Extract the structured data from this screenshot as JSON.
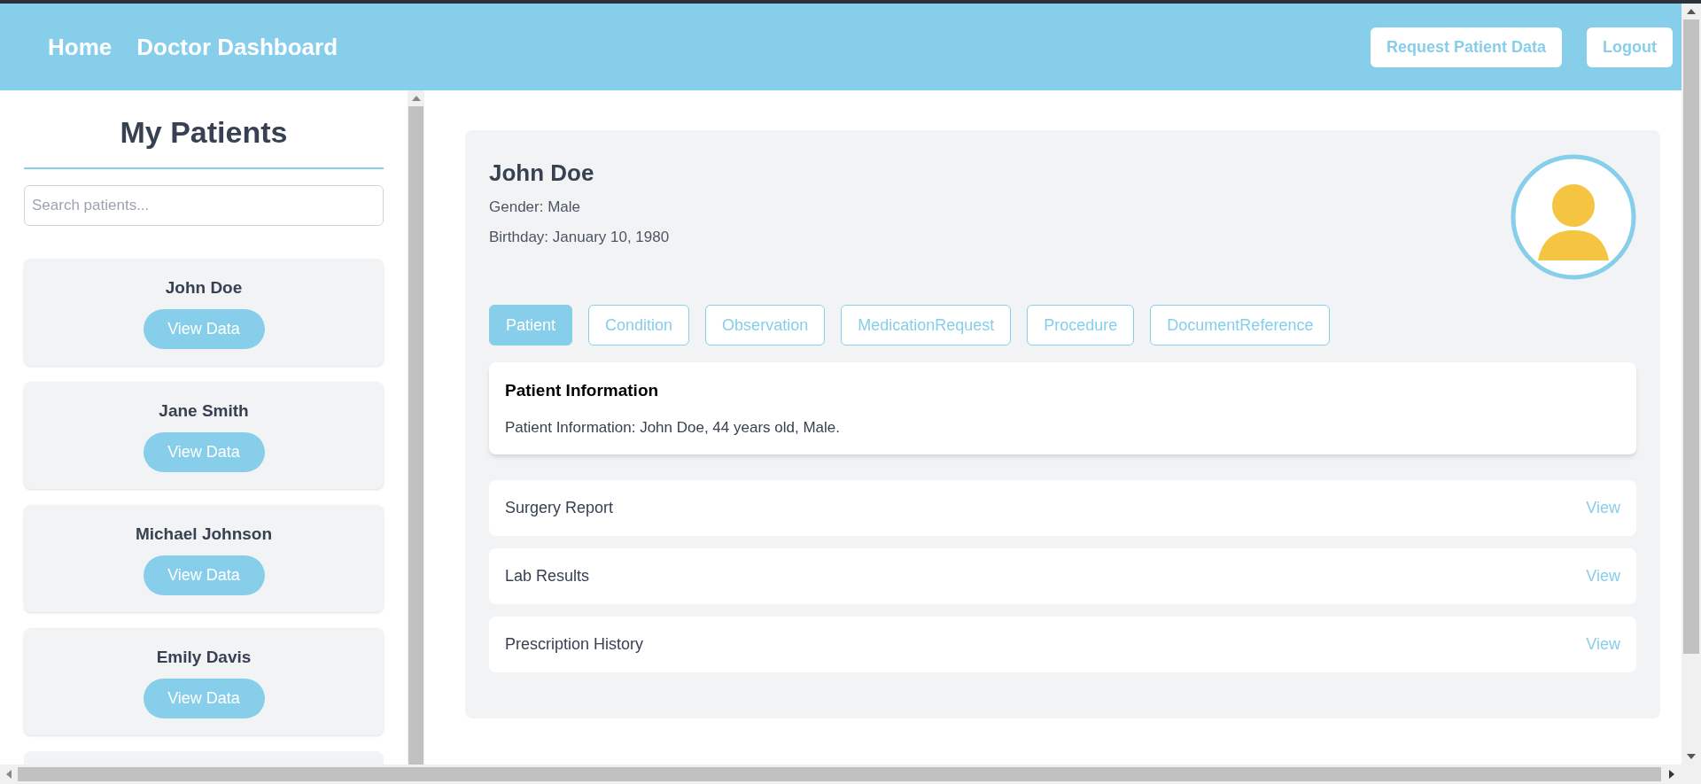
{
  "nav": {
    "links": [
      "Home",
      "Doctor Dashboard"
    ],
    "buttons": [
      "Request Patient Data",
      "Logout"
    ]
  },
  "sidebar": {
    "title": "My Patients",
    "search": {
      "placeholder": "Search patients..."
    },
    "patients": [
      {
        "name": "John Doe",
        "action": "View Data"
      },
      {
        "name": "Jane Smith",
        "action": "View Data"
      },
      {
        "name": "Michael Johnson",
        "action": "View Data"
      },
      {
        "name": "Emily Davis",
        "action": "View Data"
      }
    ]
  },
  "patient": {
    "name": "John Doe",
    "gender": "Gender: Male",
    "birthday": "Birthday: January 10, 1980",
    "tabs": [
      {
        "label": "Patient",
        "selected": true
      },
      {
        "label": "Condition",
        "selected": false
      },
      {
        "label": "Observation",
        "selected": false
      },
      {
        "label": "MedicationRequest",
        "selected": false
      },
      {
        "label": "Procedure",
        "selected": false
      },
      {
        "label": "DocumentReference",
        "selected": false
      }
    ],
    "info": {
      "title": "Patient Information",
      "text": "Patient Information: John Doe, 44 years old, Male."
    },
    "documents": [
      {
        "title": "Surgery Report",
        "action": "View"
      },
      {
        "title": "Lab Results",
        "action": "View"
      },
      {
        "title": "Prescription History",
        "action": "View"
      }
    ]
  }
}
